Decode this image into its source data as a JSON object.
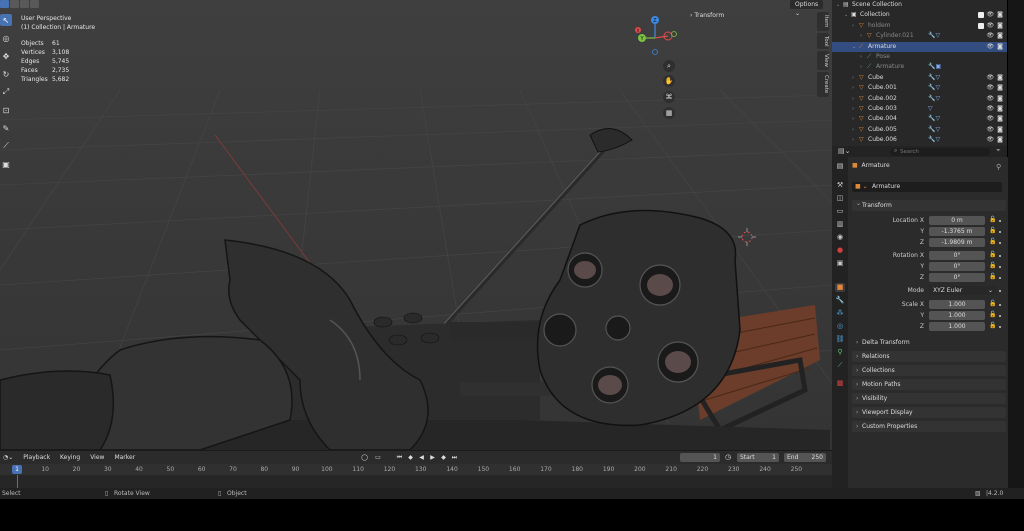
{
  "viewport": {
    "view_name": "User Perspective",
    "view_context": "(1) Collection | Armature",
    "stats": [
      {
        "label": "Objects",
        "value": "61"
      },
      {
        "label": "Vertices",
        "value": "3,108"
      },
      {
        "label": "Edges",
        "value": "5,745"
      },
      {
        "label": "Faces",
        "value": "2,735"
      },
      {
        "label": "Triangles",
        "value": "5,682"
      }
    ],
    "options_label": "Options",
    "transform_panel_label": "Transform",
    "side_tabs": [
      "Item",
      "Tool",
      "View",
      "Create"
    ],
    "gizmo_axes": {
      "x": "X",
      "y": "Y",
      "z": "Z"
    }
  },
  "timeline": {
    "menus": [
      "Playback",
      "Keying",
      "View",
      "Marker"
    ],
    "current_frame": "1",
    "start_label": "Start",
    "start_value": "1",
    "end_label": "End",
    "end_value": "250",
    "ruler_current": "1",
    "ruler_ticks": [
      "10",
      "20",
      "30",
      "40",
      "50",
      "60",
      "70",
      "80",
      "90",
      "100",
      "110",
      "120",
      "130",
      "140",
      "150",
      "160",
      "170",
      "180",
      "190",
      "200",
      "210",
      "220",
      "230",
      "240",
      "250"
    ]
  },
  "statusbar": {
    "select": "Select",
    "rotate_view": "Rotate View",
    "object": "Object",
    "version": "4.2.0"
  },
  "outliner": {
    "rows": [
      {
        "label": "Scene Collection",
        "indent": 0,
        "type": "scene"
      },
      {
        "label": "Collection",
        "indent": 1,
        "type": "collection",
        "check": true
      },
      {
        "label": "holdem",
        "indent": 2,
        "type": "obj",
        "dim": true,
        "check": true
      },
      {
        "label": "Cylinder.021",
        "indent": 3,
        "type": "obj",
        "dim": true,
        "mods": "🔧▽"
      },
      {
        "label": "Armature",
        "indent": 2,
        "type": "armature",
        "selected": true
      },
      {
        "label": "Pose",
        "indent": 3,
        "type": "pose",
        "dim": true
      },
      {
        "label": "Armature",
        "indent": 3,
        "type": "armdata",
        "dim": true,
        "mods": "🔧▣"
      },
      {
        "label": "Cube",
        "indent": 2,
        "type": "obj",
        "mods": "🔧▽"
      },
      {
        "label": "Cube.001",
        "indent": 2,
        "type": "obj",
        "mods": "🔧▽"
      },
      {
        "label": "Cube.002",
        "indent": 2,
        "type": "obj",
        "mods": "🔧▽"
      },
      {
        "label": "Cube.003",
        "indent": 2,
        "type": "obj",
        "mods": "▽"
      },
      {
        "label": "Cube.004",
        "indent": 2,
        "type": "obj",
        "mods": "🔧▽"
      },
      {
        "label": "Cube.005",
        "indent": 2,
        "type": "obj",
        "mods": "🔧▽"
      },
      {
        "label": "Cube.006",
        "indent": 2,
        "type": "obj",
        "mods": "🔧▽"
      }
    ],
    "search_placeholder": "Search"
  },
  "properties": {
    "object_name": "Armature",
    "name_field": "Armature",
    "transform_header": "Transform",
    "location_label": "Location X",
    "location": [
      "0 m",
      "-1.3765 m",
      "-1.9809 m"
    ],
    "rotation_label": "Rotation X",
    "rotation": [
      "0°",
      "0°",
      "0°"
    ],
    "mode_label": "Mode",
    "mode_value": "XYZ Euler",
    "scale_label": "Scale X",
    "scale": [
      "1.000",
      "1.000",
      "1.000"
    ],
    "axis_y": "Y",
    "axis_z": "Z",
    "sections": [
      "Delta Transform",
      "Relations",
      "Collections",
      "Motion Paths",
      "Visibility",
      "Viewport Display",
      "Custom Properties"
    ]
  },
  "colors": {
    "accent": "#4772b3",
    "selection": "#334d80",
    "axis_x": "#e24c4c",
    "axis_y": "#7bc142",
    "axis_z": "#3d8ae2"
  }
}
